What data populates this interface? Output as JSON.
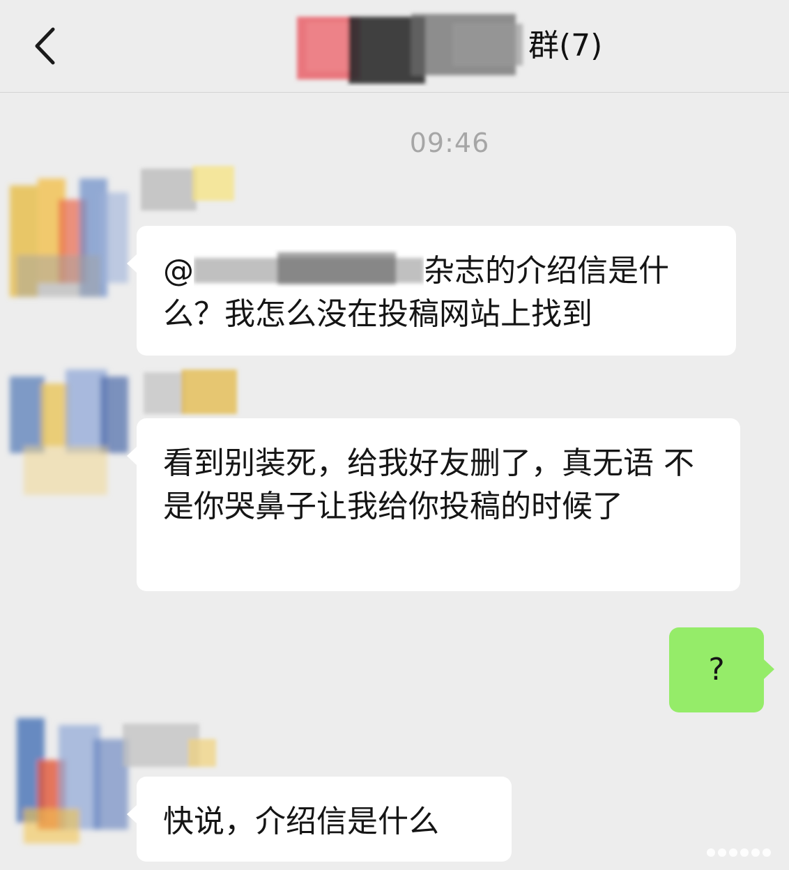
{
  "header": {
    "title_visible": "群",
    "member_count": "(7)",
    "back_label": "<"
  },
  "chat": {
    "timestamp": "09:46",
    "messages": [
      {
        "side": "left",
        "mention_prefix": "@",
        "text_after_mention": "杂志的介绍信是什么？我怎么没在投稿网站上找到"
      },
      {
        "side": "left",
        "text": "看到别装死，给我好友删了，真无语 不是你哭鼻子让我给你投稿的时候了"
      },
      {
        "side": "right",
        "text": "?"
      },
      {
        "side": "left",
        "text": "快说，介绍信是什么"
      }
    ]
  },
  "colors": {
    "background": "#ededed",
    "bubble_incoming": "#ffffff",
    "bubble_outgoing": "#95ec69",
    "timestamp": "#a6a6a6"
  },
  "icons": {
    "back": "chevron-left-icon"
  }
}
